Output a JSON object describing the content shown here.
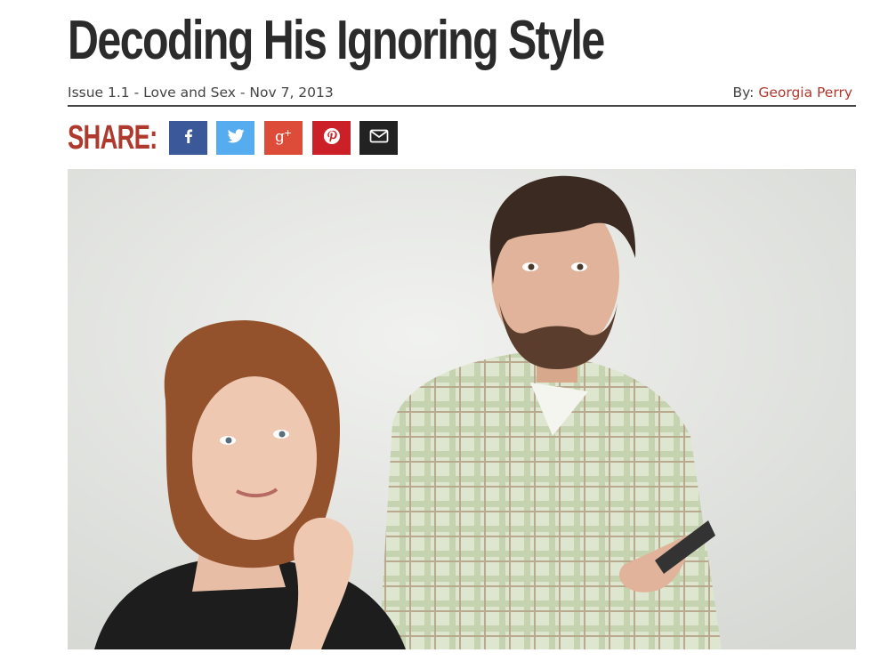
{
  "article": {
    "title": "Decoding His Ignoring Style",
    "issue_line": "Issue 1.1 - Love and Sex - Nov 7, 2013",
    "by_label": "By:",
    "author": "Georgia Perry"
  },
  "share": {
    "label": "SHARE:",
    "buttons": [
      {
        "icon": "facebook-icon",
        "color": "#3b5998"
      },
      {
        "icon": "twitter-icon",
        "color": "#55acee"
      },
      {
        "icon": "google-plus-icon",
        "color": "#dd4b39"
      },
      {
        "icon": "pinterest-icon",
        "color": "#cb2027"
      },
      {
        "icon": "email-icon",
        "color": "#222222"
      }
    ]
  },
  "colors": {
    "accent": "#b0392d",
    "title": "#2b2b2b"
  }
}
